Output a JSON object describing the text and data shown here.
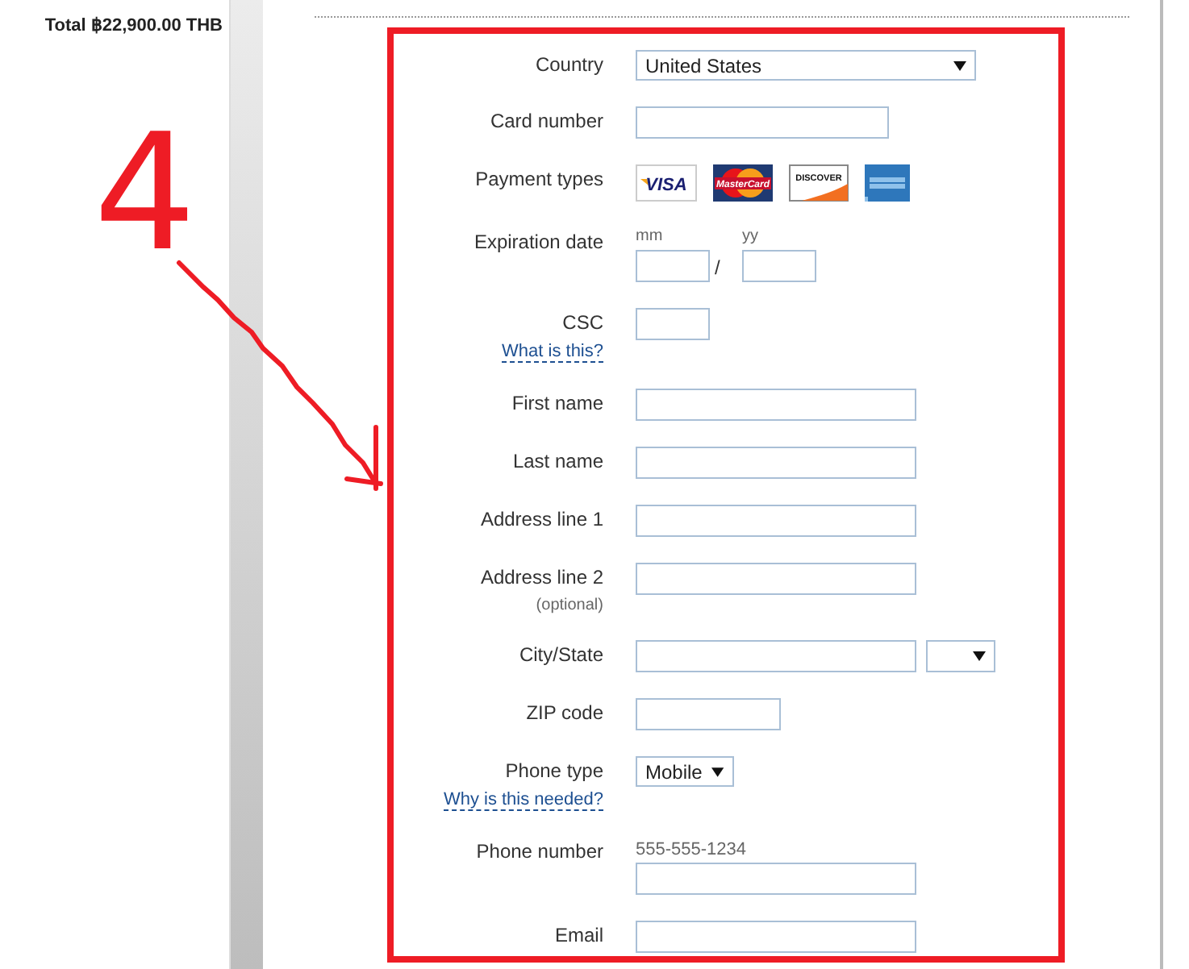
{
  "summary": {
    "total": "Total ฿22,900.00 THB"
  },
  "annotation": {
    "text": "4"
  },
  "form": {
    "rows": [
      {
        "kind": "select",
        "label": "Country",
        "value": "United States"
      },
      {
        "kind": "card_number",
        "label": "Card number"
      },
      {
        "kind": "cards",
        "label": "Payment types",
        "cards": [
          {
            "kind": "visa",
            "text": "VISA"
          },
          {
            "kind": "mastercard",
            "text": "MasterCard"
          },
          {
            "kind": "discover",
            "text": "DISCOVER"
          },
          {
            "kind": "amex"
          }
        ]
      },
      {
        "kind": "expiry",
        "label": "Expiration date",
        "month_label": "mm",
        "year_label": "yy",
        "separator": "/"
      },
      {
        "kind": "csc",
        "label": "CSC",
        "help_link": "What is this?"
      },
      {
        "kind": "text",
        "label": "First name"
      },
      {
        "kind": "text",
        "label": "Last name"
      },
      {
        "kind": "text",
        "label": "Address line 1"
      },
      {
        "kind": "text",
        "label": "Address line 2",
        "note": "(optional)"
      },
      {
        "kind": "city_state",
        "label": "City/State"
      },
      {
        "kind": "zip",
        "label": "ZIP code"
      },
      {
        "kind": "phone_type",
        "label": "Phone type",
        "value": "Mobile",
        "help_link": "Why is this needed?"
      },
      {
        "kind": "phone_number",
        "label": "Phone number",
        "example": "555-555-1234"
      },
      {
        "kind": "text",
        "label": "Email"
      }
    ]
  }
}
